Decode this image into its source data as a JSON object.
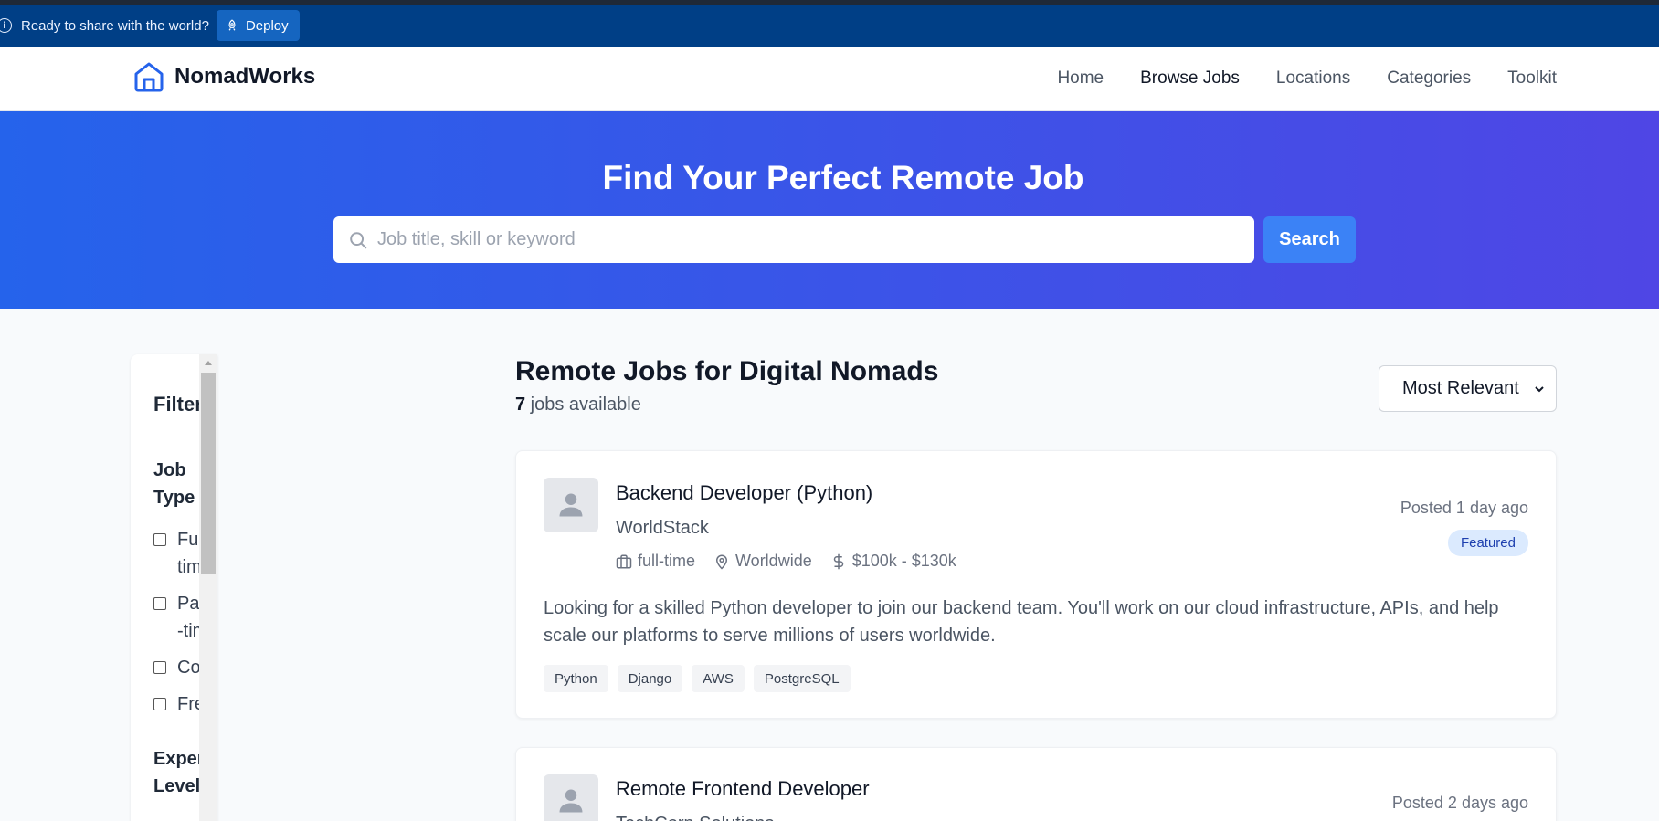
{
  "deploy_bar": {
    "message": "Ready to share with the world?",
    "button_label": "Deploy"
  },
  "nav": {
    "brand": "NomadWorks",
    "links": [
      "Home",
      "Browse Jobs",
      "Locations",
      "Categories",
      "Toolkit"
    ],
    "active": "Browse Jobs"
  },
  "hero": {
    "title": "Find Your Perfect Remote Job",
    "search_placeholder": "Job title, skill or keyword",
    "search_button": "Search"
  },
  "filters": {
    "title": "Filters",
    "job_type": {
      "title": "Job Type",
      "options": [
        "Full-time",
        "Part-time",
        "Contract",
        "Freelance"
      ]
    },
    "experience": {
      "title": "Experience Level"
    }
  },
  "listing": {
    "heading": "Remote Jobs for Digital Nomads",
    "count": "7",
    "count_suffix": " jobs available",
    "sort_selected": "Most Relevant"
  },
  "jobs": [
    {
      "title": "Backend Developer (Python)",
      "company": "WorldStack",
      "type": "full-time",
      "location": "Worldwide",
      "salary": "$100k - $130k",
      "posted": "Posted 1 day ago",
      "badge": "Featured",
      "description": "Looking for a skilled Python developer to join our backend team. You'll work on our cloud infrastructure, APIs, and help scale our platforms to serve millions of users worldwide.",
      "tags": [
        "Python",
        "Django",
        "AWS",
        "PostgreSQL"
      ]
    },
    {
      "title": "Remote Frontend Developer",
      "company": "TechCorp Solutions",
      "posted": "Posted 2 days ago"
    }
  ],
  "colors": {
    "deploy_bar": "#003f86",
    "hero_start": "#2563eb",
    "hero_end": "#4f46e5",
    "accent": "#3b82f6",
    "badge_bg": "#dbeafe"
  }
}
